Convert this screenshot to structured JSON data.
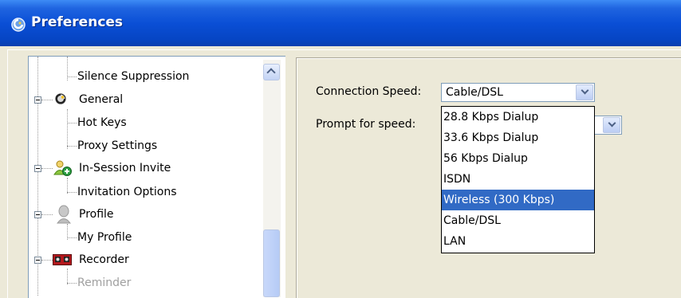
{
  "window": {
    "title": "Preferences",
    "icon": "app-logo-icon"
  },
  "tree": {
    "items": [
      {
        "label": "Silence Suppression",
        "level": 1,
        "icon": null,
        "expander": false
      },
      {
        "label": "General",
        "level": 0,
        "icon": "general-settings-icon",
        "expander": true
      },
      {
        "label": "Hot Keys",
        "level": 1,
        "icon": null,
        "expander": false
      },
      {
        "label": "Proxy Settings",
        "level": 1,
        "icon": null,
        "expander": false
      },
      {
        "label": "In-Session Invite",
        "level": 0,
        "icon": "invite-user-icon",
        "expander": true
      },
      {
        "label": "Invitation Options",
        "level": 1,
        "icon": null,
        "expander": false
      },
      {
        "label": "Profile",
        "level": 0,
        "icon": "profile-person-icon",
        "expander": true
      },
      {
        "label": "My Profile",
        "level": 1,
        "icon": null,
        "expander": false
      },
      {
        "label": "Recorder",
        "level": 0,
        "icon": "recorder-tape-icon",
        "expander": true
      },
      {
        "label": "Reminder",
        "level": 1,
        "icon": null,
        "expander": false,
        "disabled": true
      }
    ]
  },
  "settings": {
    "connection_speed": {
      "label": "Connection Speed:",
      "value": "Cable/DSL"
    },
    "prompt_for_speed": {
      "label": "Prompt for speed:",
      "value": ""
    },
    "speed_options": [
      "28.8 Kbps Dialup",
      "33.6 Kbps Dialup",
      "56 Kbps Dialup",
      "ISDN",
      "Wireless (300 Kbps)",
      "Cable/DSL",
      "LAN"
    ],
    "highlighted_option": "Wireless (300 Kbps)"
  },
  "colors": {
    "titlebar": "#0a4fd6",
    "selection": "#316ac5",
    "window_bg": "#ece9d8"
  }
}
